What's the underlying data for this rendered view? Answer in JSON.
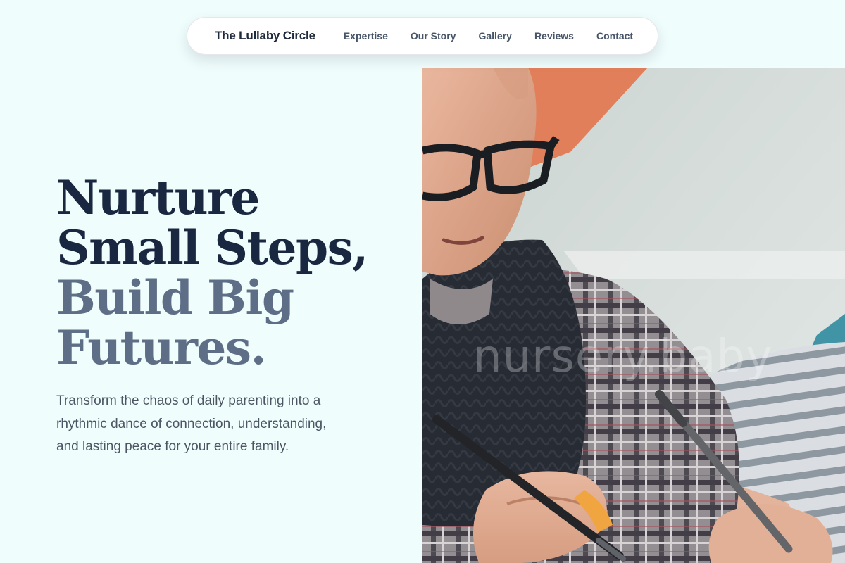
{
  "nav": {
    "brand": "The Lullaby Circle",
    "links": [
      "Expertise",
      "Our Story",
      "Gallery",
      "Reviews",
      "Contact"
    ]
  },
  "hero": {
    "headline_line1": "Nurture",
    "headline_line2": "Small Steps,",
    "headline_line3": "Build Big",
    "headline_line4": "Futures.",
    "subtext": "Transform the chaos of daily parenting into a rhythmic dance of connection, understanding, and lasting peace for your entire family."
  },
  "photo": {
    "watermark": "nursery.baby",
    "subject": "elderly man with glasses writing with a pen beside a child"
  },
  "colors": {
    "background": "#f0fdfd",
    "headline_dark": "#1a2740",
    "headline_muted": "#5f6e87",
    "body_text": "#4b5563",
    "nav_text": "#475569"
  }
}
